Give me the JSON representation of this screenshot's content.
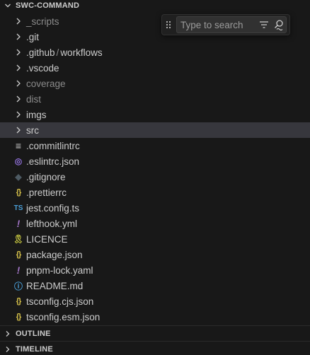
{
  "explorer": {
    "title": "SWC-COMMAND",
    "items": [
      {
        "label": "_scripts",
        "kind": "folder",
        "dim": true
      },
      {
        "label": ".git",
        "kind": "folder"
      },
      {
        "label": ".github",
        "label2": "workflows",
        "sep": "/",
        "kind": "folder"
      },
      {
        "label": ".vscode",
        "kind": "folder"
      },
      {
        "label": "coverage",
        "kind": "folder",
        "dim": true
      },
      {
        "label": "dist",
        "kind": "folder",
        "dim": true
      },
      {
        "label": "imgs",
        "kind": "folder"
      },
      {
        "label": "src",
        "kind": "folder",
        "selected": true
      },
      {
        "label": ".commitlintrc",
        "kind": "file",
        "icon": "lines-icon",
        "glyph": "≡",
        "color": "#cccccc"
      },
      {
        "label": ".eslintrc.json",
        "kind": "file",
        "icon": "eslint-icon",
        "glyph": "◎",
        "color": "#8f6fd8"
      },
      {
        "label": ".gitignore",
        "kind": "file",
        "icon": "git-icon",
        "glyph": "◆",
        "color": "#4d5a63"
      },
      {
        "label": ".prettierrc",
        "kind": "file",
        "icon": "braces-icon",
        "glyph": "{}",
        "color": "#d7c24a"
      },
      {
        "label": "jest.config.ts",
        "kind": "file",
        "icon": "typescript-icon",
        "glyph": "TS",
        "color": "#4a9fd8"
      },
      {
        "label": "lefthook.yml",
        "kind": "file",
        "icon": "yaml-icon",
        "glyph": "!",
        "color": "#a074c4"
      },
      {
        "label": "LICENCE",
        "kind": "file",
        "icon": "license-icon",
        "glyph": "🎗",
        "color": "#cbcb41"
      },
      {
        "label": "package.json",
        "kind": "file",
        "icon": "braces-icon",
        "glyph": "{}",
        "color": "#d7c24a"
      },
      {
        "label": "pnpm-lock.yaml",
        "kind": "file",
        "icon": "yaml-icon",
        "glyph": "!",
        "color": "#a074c4"
      },
      {
        "label": "README.md",
        "kind": "file",
        "icon": "info-icon",
        "glyph": "ⓘ",
        "color": "#4a9fd8"
      },
      {
        "label": "tsconfig.cjs.json",
        "kind": "file",
        "icon": "braces-icon",
        "glyph": "{}",
        "color": "#d7c24a"
      },
      {
        "label": "tsconfig.esm.json",
        "kind": "file",
        "icon": "braces-icon",
        "glyph": "{}",
        "color": "#d7c24a"
      }
    ]
  },
  "outline": {
    "title": "OUTLINE"
  },
  "timeline": {
    "title": "TIMELINE"
  },
  "find": {
    "placeholder": "Type to search"
  },
  "colors": {
    "background": "#181818",
    "selected": "#37373d",
    "text": "#cccccc",
    "dim_text": "#8b8b8b"
  }
}
